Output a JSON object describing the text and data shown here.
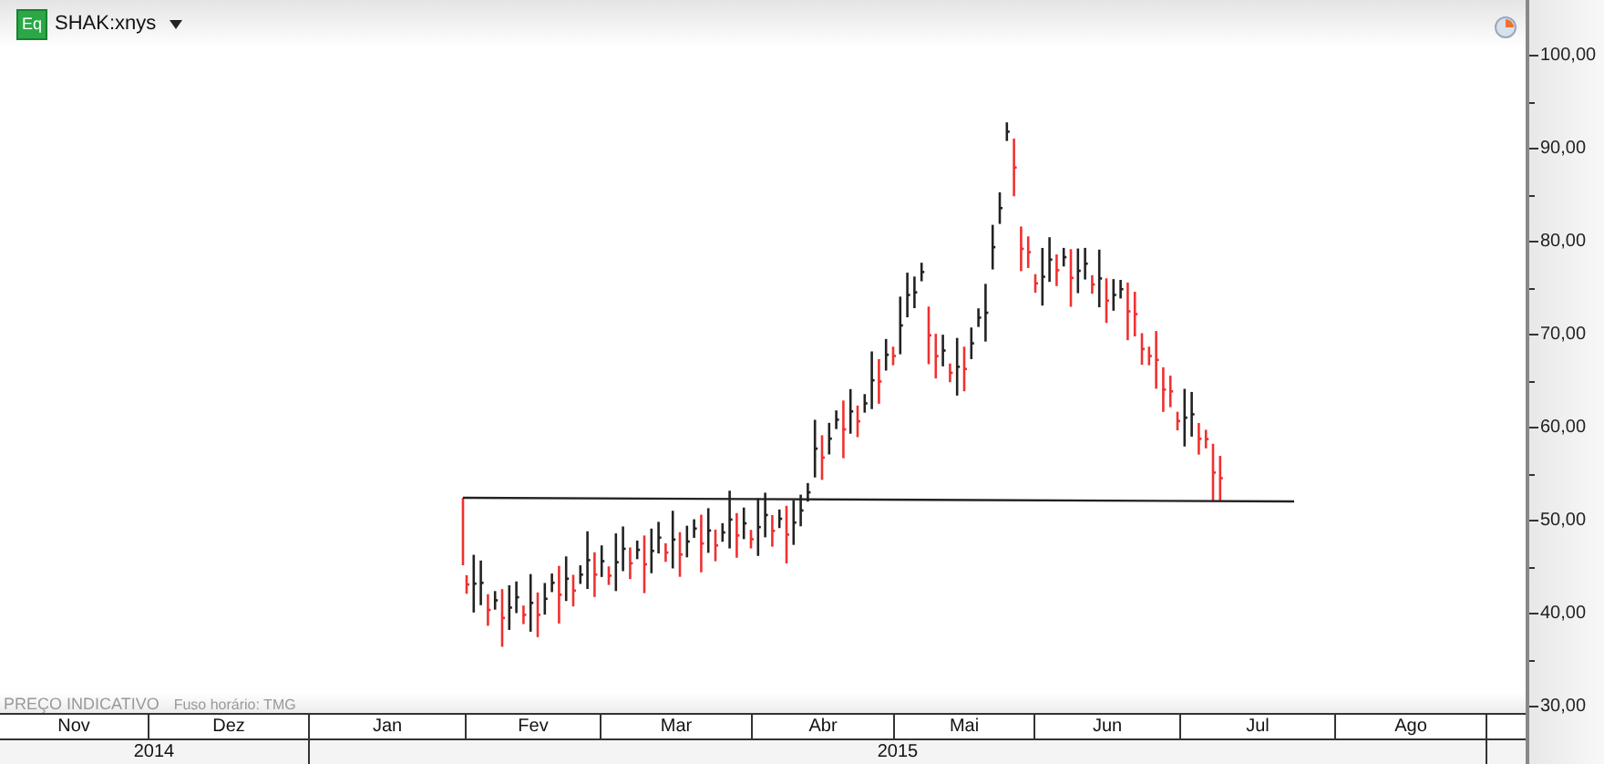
{
  "header": {
    "badge": "Eq",
    "symbol": "SHAK:xnys"
  },
  "y_axis": {
    "labels": [
      "100,00",
      "90,00",
      "80,00",
      "70,00",
      "60,00",
      "50,00",
      "40,00",
      "30,00"
    ]
  },
  "footer_note": {
    "price_type": "PREÇO INDICATIVO",
    "timezone": "Fuso horário: TMG"
  },
  "timeline": [
    {
      "year": "2014",
      "months": [
        "Nov",
        "Dez"
      ]
    },
    {
      "year": "2015",
      "months": [
        "Jan",
        "Fev",
        "Mar",
        "Abr",
        "Mai",
        "Jun",
        "Jul",
        "Ago"
      ]
    }
  ]
}
